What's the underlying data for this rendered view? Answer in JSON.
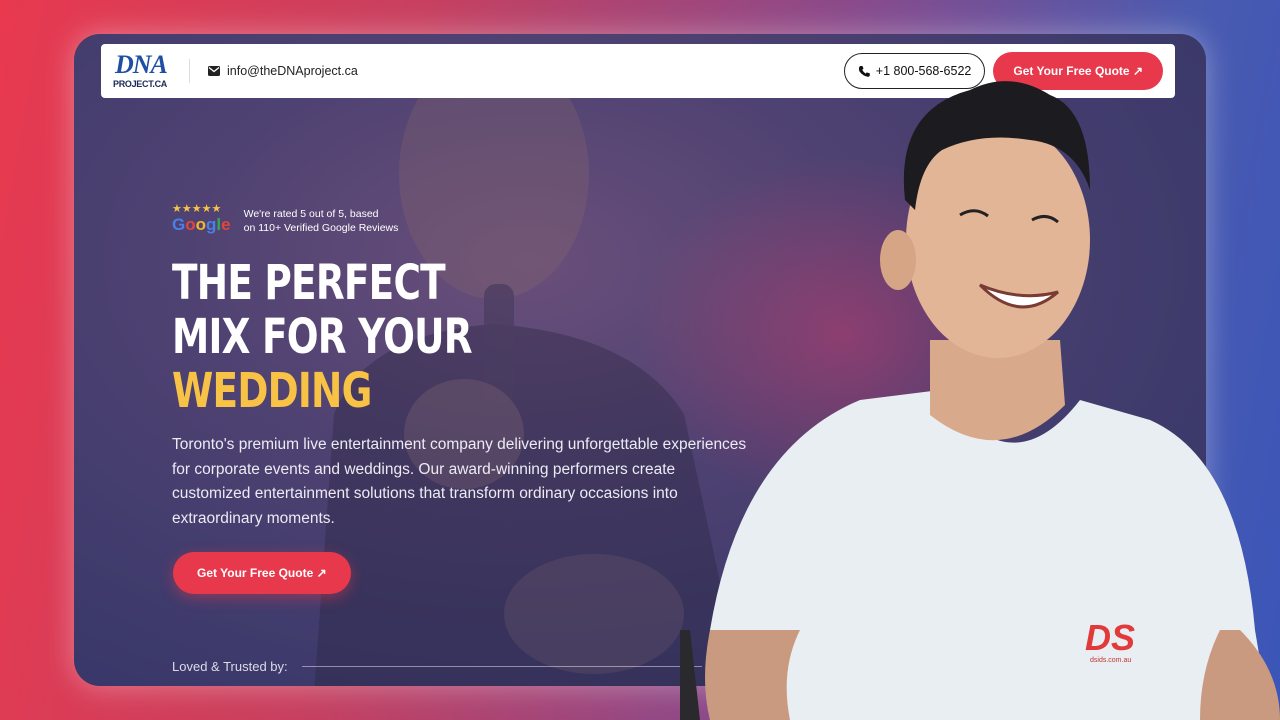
{
  "navbar": {
    "logo_text": "DNA",
    "logo_sub": "PROJECT.CA",
    "email": "info@theDNAproject.ca",
    "phone": "+1 800-568-6522",
    "quote_label": "Get Your Free Quote ↗"
  },
  "hero": {
    "stars": "★★★★★",
    "google": [
      "G",
      "o",
      "o",
      "g",
      "l",
      "e"
    ],
    "rating_line1": "We're rated 5 out of 5, based",
    "rating_line2": "on 110+ Verified Google Reviews",
    "headline_line1": "THE PERFECT",
    "headline_line2": "MIX FOR YOUR",
    "headline_line3": "WEDDING",
    "description": "Toronto's premium live entertainment company delivering unforgettable experiences for corporate events and weddings. Our award-winning performers create customized entertainment solutions that transform ordinary occasions into extraordinary moments.",
    "cta_label": "Get Your Free Quote ↗",
    "trusted_label": "Loved & Trusted by:"
  },
  "presenter": {
    "shirt_logo": "DS",
    "shirt_sub": "dsids.com.au"
  },
  "colors": {
    "accent_red": "#e8384b",
    "accent_yellow": "#f7c245",
    "logo_blue": "#1f4fa5"
  }
}
